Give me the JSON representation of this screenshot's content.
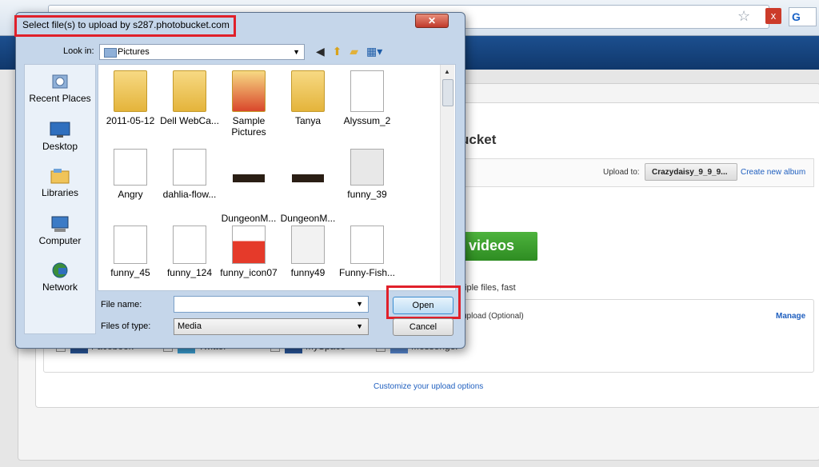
{
  "browser": {
    "star_icon": "star-icon",
    "close_label": "x",
    "search_engine_glyph": "G"
  },
  "page": {
    "title_partial": "ucket",
    "upload_to_label": "Upload to:",
    "album_value": "Crazydaisy_9_9_9...",
    "create_album": "Create new album",
    "videos_button": "videos",
    "multi_files_text": "tiple files, fast",
    "upload_optional": "upload (Optional)",
    "manage_link": "Manage",
    "share": [
      "Facebook",
      "Twitter",
      "MySpace",
      "Messenger"
    ],
    "customize_link": "Customize your upload options"
  },
  "dialog": {
    "title": "Select file(s) to upload by s287.photobucket.com",
    "close_label": "✕",
    "look_in_label": "Look in:",
    "look_in_value": "Pictures",
    "places": [
      {
        "label": "Recent Places",
        "icon": "recent-places-icon"
      },
      {
        "label": "Desktop",
        "icon": "desktop-icon"
      },
      {
        "label": "Libraries",
        "icon": "libraries-icon"
      },
      {
        "label": "Computer",
        "icon": "computer-icon"
      },
      {
        "label": "Network",
        "icon": "network-icon"
      }
    ],
    "files": [
      {
        "name": "2011-05-12",
        "kind": "folder"
      },
      {
        "name": "Dell WebCa...",
        "kind": "folder"
      },
      {
        "name": "Sample Pictures",
        "kind": "folder"
      },
      {
        "name": "Tanya",
        "kind": "folder"
      },
      {
        "name": "Alyssum_2",
        "kind": "image"
      },
      {
        "name": "Angry",
        "kind": "image"
      },
      {
        "name": "dahlia-flow...",
        "kind": "image"
      },
      {
        "name": "DungeonM...",
        "kind": "dark"
      },
      {
        "name": "DungeonM...",
        "kind": "dark"
      },
      {
        "name": "funny_39",
        "kind": "image"
      },
      {
        "name": "funny_45",
        "kind": "image"
      },
      {
        "name": "funny_124",
        "kind": "image"
      },
      {
        "name": "funny_icon07",
        "kind": "image"
      },
      {
        "name": "funny49",
        "kind": "image"
      },
      {
        "name": "Funny-Fish...",
        "kind": "image"
      }
    ],
    "file_name_label": "File name:",
    "file_name_value": "",
    "files_of_type_label": "Files of type:",
    "files_of_type_value": "Media",
    "open_button": "Open",
    "cancel_button": "Cancel"
  },
  "colors": {
    "highlight": "#e0202a",
    "link": "#1f5fbf",
    "green_button": "#3aa02d"
  }
}
